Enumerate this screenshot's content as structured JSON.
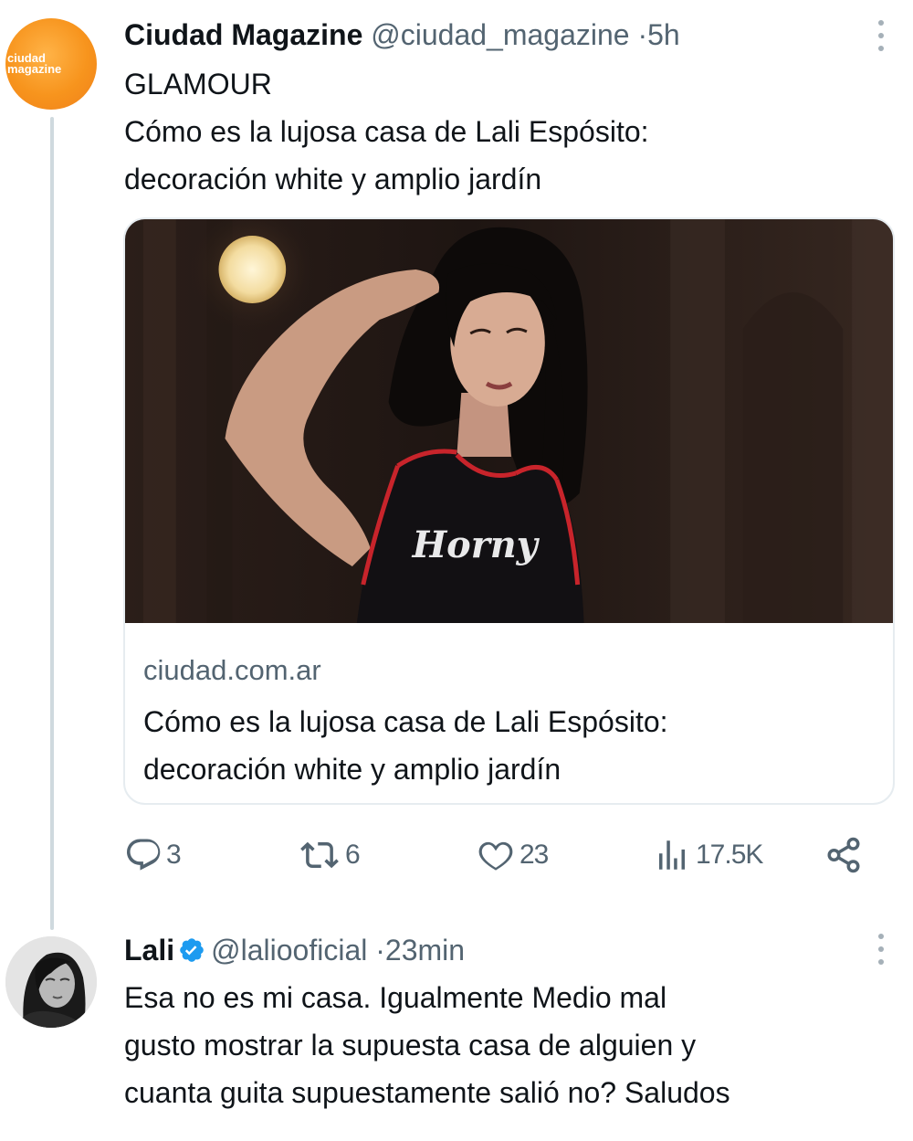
{
  "tweet1": {
    "author_name": "Ciudad Magazine",
    "handle": "@ciudad_magazine",
    "time": "5h",
    "avatar_text_line1": "ciudad",
    "avatar_text_line2": "magazine",
    "text_line1": "GLAMOUR",
    "text_line2": "Cómo es la lujosa casa de Lali Espósito:",
    "text_line3": "decoración white y amplio jardín",
    "card": {
      "shirt_text": "Horny",
      "domain": "ciudad.com.ar",
      "title_line1": "Cómo es la lujosa casa de Lali Espósito:",
      "title_line2": "decoración white y amplio jardín"
    },
    "actions": {
      "replies": "3",
      "reposts": "6",
      "likes": "23",
      "views": "17.5K"
    }
  },
  "tweet2": {
    "author_name": "Lali",
    "handle": "@laliooficial",
    "time": "23min",
    "text_line1": "Esa no es mi casa. Igualmente Medio mal",
    "text_line2": "gusto mostrar la supuesta casa de alguien y",
    "text_line3": "cuanta guita supuestamente salió no? Saludos"
  },
  "colors": {
    "text_primary": "#0f1419",
    "text_secondary": "#536471",
    "verified_blue": "#1d9bf0",
    "brand_orange": "#f7941d",
    "shirt_trim": "#c8242b"
  },
  "icons": [
    "reply-icon",
    "repost-icon",
    "like-icon",
    "views-icon",
    "share-icon",
    "verified-badge-icon",
    "more-icon"
  ]
}
